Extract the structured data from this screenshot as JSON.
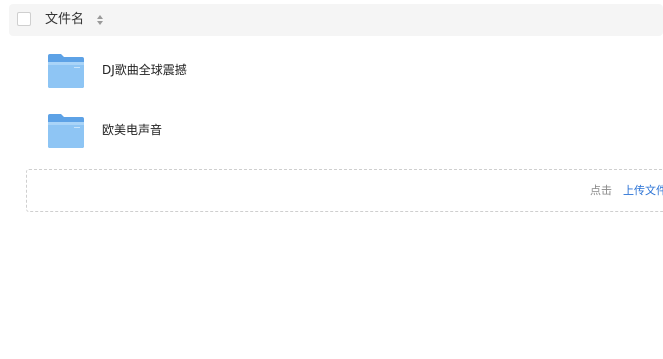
{
  "header": {
    "column_label": "文件名",
    "sort_icon": "sort-caret-icon"
  },
  "files": [
    {
      "name": "DJ歌曲全球震撼",
      "icon": "folder-icon"
    },
    {
      "name": "欧美电声音",
      "icon": "folder-icon"
    }
  ],
  "upload": {
    "hint": "点击",
    "link": "上传文件"
  },
  "colors": {
    "header_bg": "#f5f5f5",
    "folder_blue": "#7ab8f0",
    "link_blue": "#2a72d5"
  }
}
